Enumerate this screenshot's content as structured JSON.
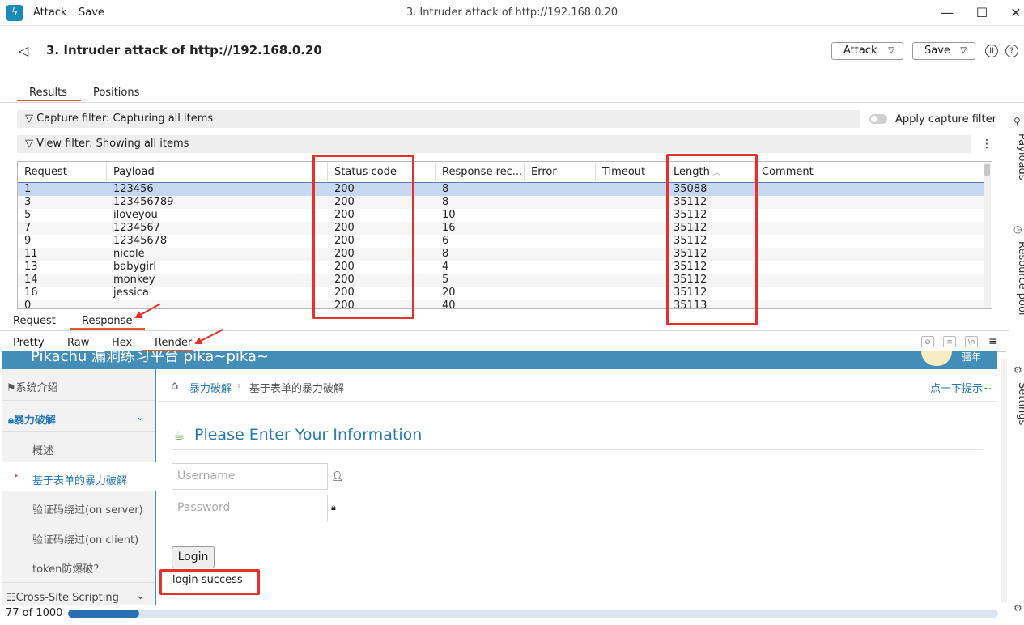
{
  "titlebar": {
    "menu_attack": "Attack",
    "menu_save": "Save",
    "window_title": "3. Intruder attack of http://192.168.0.20",
    "logo_icon": "lightning-icon"
  },
  "header": {
    "title": "3. Intruder attack of http://192.168.0.20",
    "attack_label": "Attack",
    "save_label": "Save",
    "pause_icon": "pause-icon",
    "help_icon": "help-icon"
  },
  "tabs": [
    {
      "label": "Results",
      "active": true
    },
    {
      "label": "Positions",
      "active": false
    }
  ],
  "sidebar": {
    "payloads": "Payloads",
    "resource_pool": "Resource pool",
    "settings": "Settings"
  },
  "filters": {
    "capture": "Capture filter: Capturing all items",
    "view": "View filter: Showing all items",
    "apply_capture": "Apply capture filter"
  },
  "table": {
    "columns": [
      "Request",
      "Payload",
      "Status code",
      "Response rec...",
      "Error",
      "Timeout",
      "Length",
      "Comment"
    ],
    "rows": [
      {
        "request": "1",
        "payload": "123456",
        "status": "200",
        "received": "8",
        "length": "35088"
      },
      {
        "request": "3",
        "payload": "123456789",
        "status": "200",
        "received": "8",
        "length": "35112"
      },
      {
        "request": "5",
        "payload": "iloveyou",
        "status": "200",
        "received": "10",
        "length": "35112"
      },
      {
        "request": "7",
        "payload": "1234567",
        "status": "200",
        "received": "16",
        "length": "35112"
      },
      {
        "request": "9",
        "payload": "12345678",
        "status": "200",
        "received": "6",
        "length": "35112"
      },
      {
        "request": "11",
        "payload": "nicole",
        "status": "200",
        "received": "8",
        "length": "35112"
      },
      {
        "request": "13",
        "payload": "babygirl",
        "status": "200",
        "received": "4",
        "length": "35112"
      },
      {
        "request": "14",
        "payload": "monkey",
        "status": "200",
        "received": "5",
        "length": "35112"
      },
      {
        "request": "16",
        "payload": "jessica",
        "status": "200",
        "received": "20",
        "length": "35112"
      },
      {
        "request": "0",
        "payload": "",
        "status": "200",
        "received": "40",
        "length": "35113"
      }
    ]
  },
  "message_tabs": {
    "request": "Request",
    "response": "Response"
  },
  "view_tabs": {
    "pretty": "Pretty",
    "raw": "Raw",
    "hex": "Hex",
    "render": "Render",
    "ln": "\\n"
  },
  "render": {
    "banner_text": "Pikachu 漏洞练习平台 pika~pika~",
    "banner_user": "骚年",
    "nav_items": [
      "系统介绍",
      "暴力破解",
      "概述",
      "基于表单的暴力破解",
      "验证码绕过(on server)",
      "验证码绕过(on client)",
      "token防爆破?",
      "Cross-Site Scripting"
    ],
    "breadcrumb_1": "暴力破解",
    "breadcrumb_2": "基于表单的暴力破解",
    "hint": "点一下提示~",
    "form_title": "Please Enter Your Information",
    "username_placeholder": "Username",
    "password_placeholder": "Password",
    "login_label": "Login",
    "login_message": "login success"
  },
  "status": {
    "count": "77 of 1000",
    "progress": 0.077
  },
  "colors": {
    "accent": "#e5572f",
    "annotation": "#e5302d",
    "selection": "#c6d8f0",
    "render_blue": "#438eb9"
  }
}
